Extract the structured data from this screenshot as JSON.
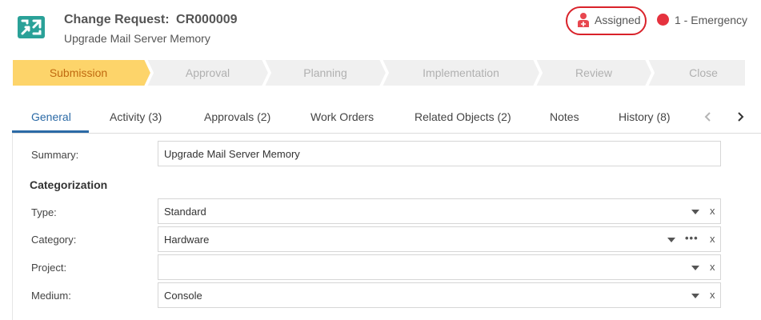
{
  "header": {
    "title_prefix": "Change Request:",
    "title_id": "CR000009",
    "subtitle": "Upgrade Mail Server Memory",
    "logo_icon": "change-request-icon"
  },
  "status": {
    "label": "Assigned",
    "icon": "user-assigned-icon",
    "highlight_color": "#d9222a"
  },
  "priority": {
    "label": "1 - Emergency",
    "color": "#e5323e"
  },
  "stages": {
    "active_index": 0,
    "active_color": "#fdd46a",
    "inactive_color": "#f0f0f0",
    "items": [
      "Submission",
      "Approval",
      "Planning",
      "Implementation",
      "Review",
      "Close"
    ]
  },
  "tabs": {
    "active_index": 0,
    "items": [
      "General",
      "Activity (3)",
      "Approvals (2)",
      "Work Orders",
      "Related Objects (2)",
      "Notes",
      "History (8)"
    ],
    "prev_icon": "chevron-left-icon",
    "next_icon": "chevron-right-icon"
  },
  "form": {
    "summary_label": "Summary:",
    "summary_value": "Upgrade Mail Server Memory",
    "section_title": "Categorization",
    "type_label": "Type:",
    "type_value": "Standard",
    "category_label": "Category:",
    "category_value": "Hardware",
    "project_label": "Project:",
    "project_value": "",
    "medium_label": "Medium:",
    "medium_value": "Console",
    "clear_glyph": "x",
    "more_glyph": "•••"
  }
}
